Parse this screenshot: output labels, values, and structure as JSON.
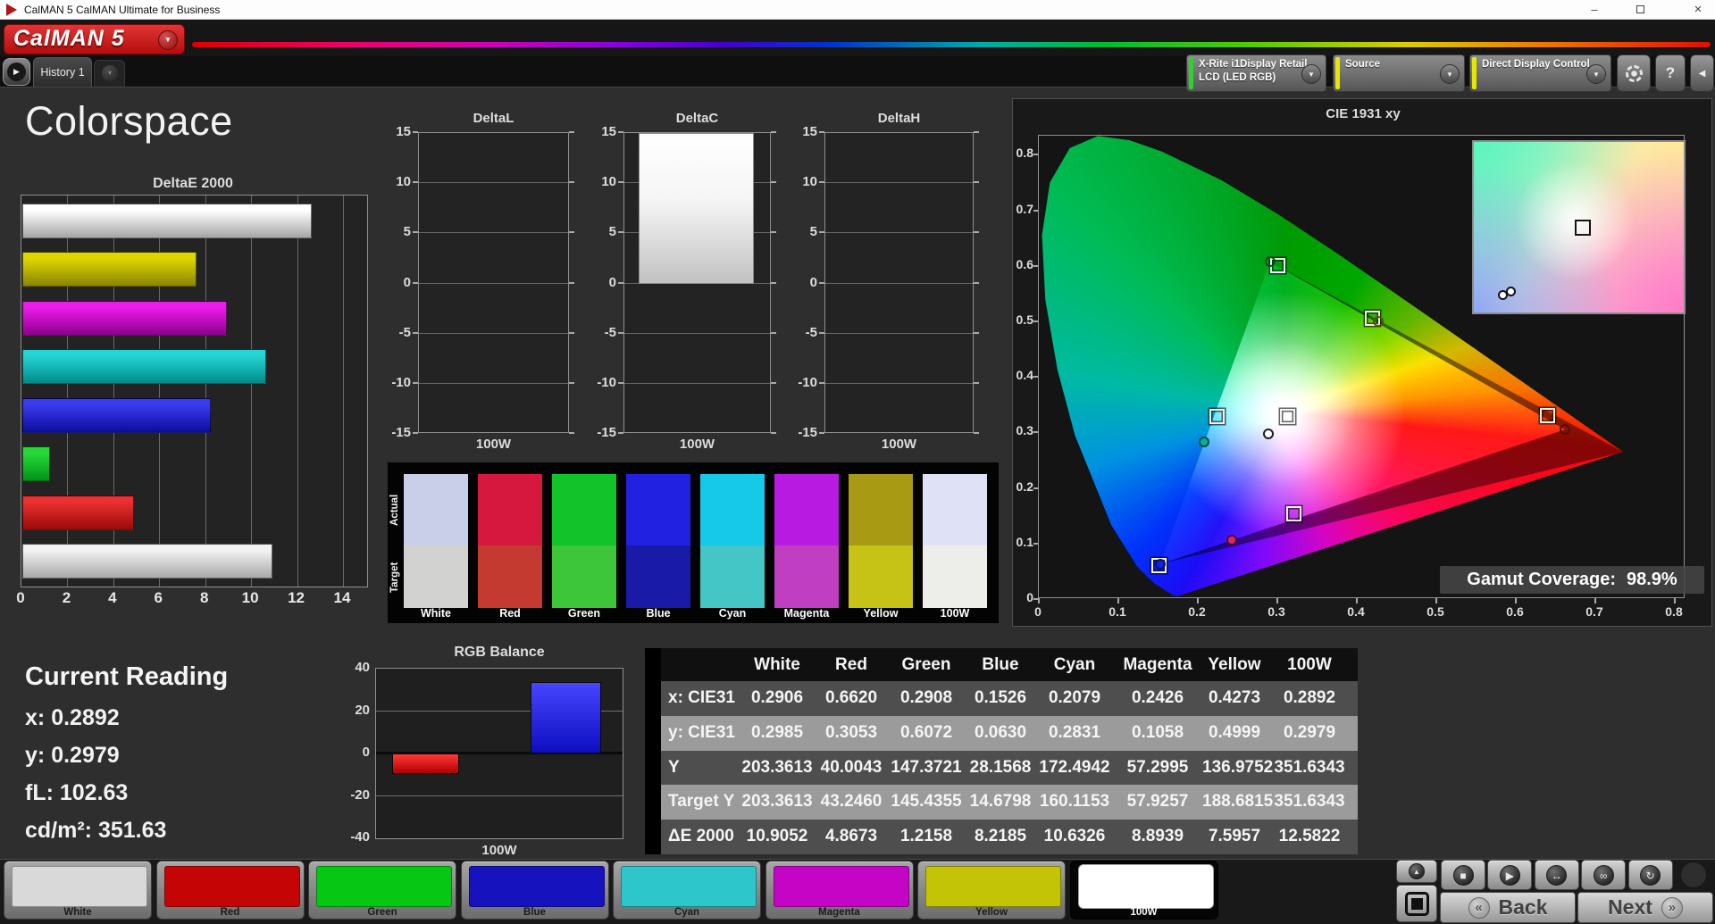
{
  "window": {
    "title": "CalMAN 5 CalMAN Ultimate for Business",
    "minimize": "–",
    "close": "×"
  },
  "brand": {
    "logo": "CalMAN 5",
    "accent_red": "#c41212",
    "caret_icon": "▼"
  },
  "tabs": {
    "history": "History 1",
    "scroll_icon": "▶",
    "add_icon": "▾"
  },
  "toolbar": {
    "meter_line1": "X-Rite i1Display Retail",
    "meter_line2": "LCD (LED RGB)",
    "meter_stripe": "#2ed42e",
    "source": "Source",
    "source_stripe": "#e6e600",
    "display_control": "Direct Display Control",
    "display_control_stripe": "#e6e600",
    "gear_icon": "gear",
    "help_icon": "?",
    "collapse_icon": "◀"
  },
  "page_title": "Colorspace",
  "deltae": {
    "title": "DeltaE 2000",
    "xticks": [
      0,
      2,
      4,
      6,
      8,
      10,
      12,
      14
    ],
    "bars": [
      {
        "label": "100W",
        "value": 12.5822,
        "top": "#ffffff",
        "bottom": "#a6a6a6"
      },
      {
        "label": "Yellow",
        "value": 7.5957,
        "top": "#ddd600",
        "bottom": "#8a8600"
      },
      {
        "label": "Magenta",
        "value": 8.8939,
        "top": "#ea1cea",
        "bottom": "#8d008d"
      },
      {
        "label": "Cyan",
        "value": 10.6326,
        "top": "#25d4d4",
        "bottom": "#008b8b"
      },
      {
        "label": "Blue",
        "value": 8.2185,
        "top": "#3a3aee",
        "bottom": "#0d0d9a"
      },
      {
        "label": "Green",
        "value": 1.2158,
        "top": "#28d838",
        "bottom": "#009416"
      },
      {
        "label": "Red",
        "value": 4.8673,
        "top": "#ea3030",
        "bottom": "#990b0b"
      },
      {
        "label": "White",
        "value": 10.9052,
        "top": "#f2f2f2",
        "bottom": "#a9a9a9"
      }
    ]
  },
  "small_deltas": {
    "yticks": [
      15,
      10,
      5,
      0,
      -5,
      -10,
      -15
    ],
    "xlabel": "100W",
    "charts": [
      {
        "title": "DeltaL",
        "value": 0
      },
      {
        "title": "DeltaC",
        "value": 15
      },
      {
        "title": "DeltaH",
        "value": 0
      }
    ]
  },
  "swatches": {
    "actual_label": "Actual",
    "target_label": "Target",
    "columns": [
      {
        "name": "White",
        "actual": "#c9cee9",
        "target": "#d2d2d0"
      },
      {
        "name": "Red",
        "actual": "#d6173e",
        "target": "#c43a31"
      },
      {
        "name": "Green",
        "actual": "#12c32a",
        "target": "#3ec63a"
      },
      {
        "name": "Blue",
        "actual": "#2121e2",
        "target": "#1a1aa8"
      },
      {
        "name": "Cyan",
        "actual": "#17c9e9",
        "target": "#45c6c6"
      },
      {
        "name": "Magenta",
        "actual": "#b91ae2",
        "target": "#c03ec1"
      },
      {
        "name": "Yellow",
        "actual": "#a89a12",
        "target": "#c7c316"
      },
      {
        "name": "100W",
        "actual": "#dfe2f6",
        "target": "#edeeea"
      }
    ]
  },
  "cie": {
    "title": "CIE 1931 xy",
    "coverage_label": "Gamut Coverage:",
    "coverage_value": "98.9%",
    "xticks": [
      "0",
      "0.1",
      "0.2",
      "0.3",
      "0.4",
      "0.5",
      "0.6",
      "0.7",
      "0.8"
    ],
    "yticks": [
      "0",
      "0.1",
      "0.2",
      "0.3",
      "0.4",
      "0.5",
      "0.6",
      "0.7",
      "0.8"
    ],
    "points": [
      {
        "name": "White",
        "target": [
          0.3127,
          0.329
        ],
        "measured": [
          0.2892,
          0.2979
        ],
        "fill": "#ffffff",
        "ring": "#1c1c1c"
      },
      {
        "name": "Red",
        "target": [
          0.64,
          0.33
        ],
        "measured": [
          0.662,
          0.3053
        ],
        "fill": "transparent",
        "ring": "#580c0c"
      },
      {
        "name": "Green",
        "target": [
          0.3,
          0.6
        ],
        "measured": [
          0.2908,
          0.6072
        ],
        "fill": "transparent",
        "ring": "#0c4a14"
      },
      {
        "name": "Blue",
        "target": [
          0.1509,
          0.06
        ],
        "measured": [
          0.1526,
          0.063
        ],
        "fill": "transparent",
        "ring": "#12124a"
      },
      {
        "name": "Cyan",
        "target": [
          0.2246,
          0.3287
        ],
        "measured": [
          0.2079,
          0.2831
        ],
        "fill": "#00b39b",
        "ring": "#0b4a42"
      },
      {
        "name": "Magenta",
        "target": [
          0.3209,
          0.1542
        ],
        "measured": [
          0.2426,
          0.1058
        ],
        "fill": "#d42a6a",
        "ring": "#58092a"
      },
      {
        "name": "Yellow",
        "target": [
          0.4193,
          0.5053
        ],
        "measured": [
          0.4273,
          0.4999
        ],
        "fill": "transparent",
        "ring": "#52520c"
      }
    ],
    "locus": [
      [
        0.1741,
        0.005
      ],
      [
        0.1714,
        0.0051
      ],
      [
        0.1689,
        0.0069
      ],
      [
        0.1644,
        0.0109
      ],
      [
        0.1566,
        0.0177
      ],
      [
        0.144,
        0.0297
      ],
      [
        0.1241,
        0.0578
      ],
      [
        0.0913,
        0.1327
      ],
      [
        0.0454,
        0.295
      ],
      [
        0.0235,
        0.4127
      ],
      [
        0.0082,
        0.5384
      ],
      [
        0.0039,
        0.6548
      ],
      [
        0.0139,
        0.7502
      ],
      [
        0.0389,
        0.812
      ],
      [
        0.0743,
        0.8338
      ],
      [
        0.1142,
        0.8262
      ],
      [
        0.1547,
        0.8059
      ],
      [
        0.2296,
        0.7543
      ],
      [
        0.3016,
        0.6923
      ],
      [
        0.3731,
        0.6245
      ],
      [
        0.4441,
        0.5547
      ],
      [
        0.5125,
        0.4866
      ],
      [
        0.5752,
        0.4242
      ],
      [
        0.627,
        0.3725
      ],
      [
        0.6658,
        0.334
      ],
      [
        0.6915,
        0.3083
      ],
      [
        0.7079,
        0.292
      ],
      [
        0.719,
        0.2809
      ],
      [
        0.7347,
        0.2653
      ]
    ],
    "native_red": [
      0.735,
      0.265
    ]
  },
  "current_reading": {
    "title": "Current Reading",
    "rows": [
      {
        "label": "x:",
        "value": "0.2892"
      },
      {
        "label": "y:",
        "value": "0.2979"
      },
      {
        "label": "fL:",
        "value": "102.63"
      },
      {
        "label": "cd/m²:",
        "value": "351.63"
      }
    ]
  },
  "rgb_balance": {
    "title": "RGB Balance",
    "yticks": [
      40,
      20,
      0,
      -20,
      -40
    ],
    "xlabel": "100W",
    "bars": [
      {
        "name": "red",
        "value": -9.8,
        "top": "#ff3a3a",
        "bottom": "#b00000"
      },
      {
        "name": "green",
        "value": 0,
        "top": "#2ad838",
        "bottom": "#009416"
      },
      {
        "name": "blue",
        "value": 33.6,
        "top": "#4646ff",
        "bottom": "#0d0dc0"
      }
    ]
  },
  "table": {
    "columns": [
      "White",
      "Red",
      "Green",
      "Blue",
      "Cyan",
      "Magenta",
      "Yellow",
      "100W"
    ],
    "rows": [
      {
        "label": "x: CIE31",
        "values": [
          "0.2906",
          "0.6620",
          "0.2908",
          "0.1526",
          "0.2079",
          "0.2426",
          "0.4273",
          "0.2892"
        ]
      },
      {
        "label": "y: CIE31",
        "values": [
          "0.2985",
          "0.3053",
          "0.6072",
          "0.0630",
          "0.2831",
          "0.1058",
          "0.4999",
          "0.2979"
        ]
      },
      {
        "label": "Y",
        "values": [
          "203.3613",
          "40.0043",
          "147.3721",
          "28.1568",
          "172.4942",
          "57.2995",
          "136.9752",
          "351.6343"
        ]
      },
      {
        "label": "Target Y",
        "values": [
          "203.3613",
          "43.2460",
          "145.4355",
          "14.6798",
          "160.1153",
          "57.9257",
          "188.6815",
          "351.6343"
        ]
      },
      {
        "label": "ΔE 2000",
        "values": [
          "10.9052",
          "4.8673",
          "1.2158",
          "8.2185",
          "10.6326",
          "8.8939",
          "7.5957",
          "12.5822"
        ]
      }
    ]
  },
  "bottom_bar": {
    "buttons": [
      {
        "label": "White",
        "color": "#d9d9d9",
        "selected": false
      },
      {
        "label": "Red",
        "color": "#c50505",
        "selected": false
      },
      {
        "label": "Green",
        "color": "#05c714",
        "selected": false
      },
      {
        "label": "Blue",
        "color": "#1512be",
        "selected": false
      },
      {
        "label": "Cyan",
        "color": "#2cc6cb",
        "selected": false
      },
      {
        "label": "Magenta",
        "color": "#c405c6",
        "selected": false
      },
      {
        "label": "Yellow",
        "color": "#c3c405",
        "selected": false
      },
      {
        "label": "100W",
        "color": "#ffffff",
        "selected": true
      }
    ]
  },
  "transport": {
    "up_icon": "▲",
    "icons": [
      {
        "name": "stop-icon",
        "glyph": "■"
      },
      {
        "name": "play-icon",
        "glyph": "▶"
      },
      {
        "name": "step-icon",
        "glyph": "↔"
      },
      {
        "name": "loop-icon",
        "glyph": "∞"
      },
      {
        "name": "refresh-icon",
        "glyph": "↻"
      }
    ],
    "back": "Back",
    "next": "Next",
    "back_icon": "«",
    "next_icon": "»"
  },
  "chart_data": [
    {
      "type": "bar",
      "title": "DeltaE 2000",
      "orientation": "horizontal",
      "categories": [
        "100W",
        "Yellow",
        "Magenta",
        "Cyan",
        "Blue",
        "Green",
        "Red",
        "White"
      ],
      "values": [
        12.5822,
        7.5957,
        8.8939,
        10.6326,
        8.2185,
        1.2158,
        4.8673,
        10.9052
      ],
      "xlabel": "",
      "ylabel": "",
      "xlim": [
        0,
        15
      ],
      "grid": true
    },
    {
      "type": "bar",
      "title": "DeltaL",
      "categories": [
        "100W"
      ],
      "values": [
        0
      ],
      "ylim": [
        -15,
        15
      ]
    },
    {
      "type": "bar",
      "title": "DeltaC",
      "categories": [
        "100W"
      ],
      "values": [
        15
      ],
      "ylim": [
        -15,
        15
      ],
      "note": "bar clipped at +15"
    },
    {
      "type": "bar",
      "title": "DeltaH",
      "categories": [
        "100W"
      ],
      "values": [
        0
      ],
      "ylim": [
        -15,
        15
      ]
    },
    {
      "type": "bar",
      "title": "RGB Balance",
      "categories": [
        "100W"
      ],
      "ylim": [
        -40,
        40
      ],
      "series": [
        {
          "name": "Red",
          "values": [
            -9.8
          ]
        },
        {
          "name": "Green",
          "values": [
            0
          ]
        },
        {
          "name": "Blue",
          "values": [
            33.6
          ]
        }
      ]
    },
    {
      "type": "scatter",
      "title": "CIE 1931 xy",
      "xlim": [
        0,
        0.8
      ],
      "ylim": [
        0,
        0.85
      ],
      "series": [
        {
          "name": "targets",
          "points": [
            [
              0.3127,
              0.329
            ],
            [
              0.64,
              0.33
            ],
            [
              0.3,
              0.6
            ],
            [
              0.1509,
              0.06
            ],
            [
              0.2246,
              0.3287
            ],
            [
              0.3209,
              0.1542
            ],
            [
              0.4193,
              0.5053
            ]
          ]
        },
        {
          "name": "measured",
          "points": [
            [
              0.2892,
              0.2979
            ],
            [
              0.662,
              0.3053
            ],
            [
              0.2908,
              0.6072
            ],
            [
              0.1526,
              0.063
            ],
            [
              0.2079,
              0.2831
            ],
            [
              0.2426,
              0.1058
            ],
            [
              0.4273,
              0.4999
            ]
          ]
        }
      ],
      "annotations": [
        "Gamut Coverage: 98.9%"
      ]
    }
  ]
}
